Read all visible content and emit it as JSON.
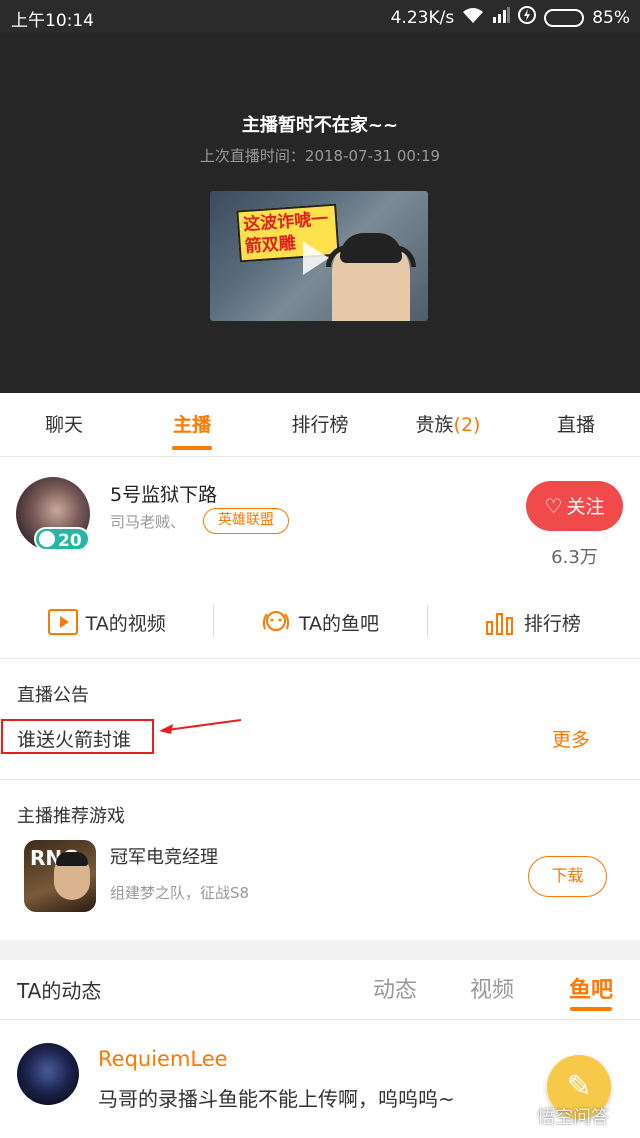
{
  "status_bar": {
    "time": "上午10:14",
    "network_speed": "4.23K/s",
    "battery": "85%",
    "battery_level": 0.85
  },
  "player": {
    "offline_title": "主播暂时不在家~~",
    "last_live": "上次直播时间：2018-07-31  00:19",
    "replay_caption": "这波诈唬一箭双雕"
  },
  "tabs": [
    {
      "label": "聊天"
    },
    {
      "label": "主播"
    },
    {
      "label": "排行榜"
    },
    {
      "label": "贵族",
      "count": "(2)"
    },
    {
      "label": "直播"
    }
  ],
  "anchor": {
    "name": "5号监狱下路",
    "nickname": "司马老贼、",
    "category": "英雄联盟",
    "level": "20",
    "follow_label": "关注",
    "followers": "6.3万"
  },
  "shortcuts": [
    {
      "label": "TA的视频",
      "icon": "video-icon"
    },
    {
      "label": "TA的鱼吧",
      "icon": "fish-bar-icon"
    },
    {
      "label": "排行榜",
      "icon": "rank-bars-icon"
    }
  ],
  "announcement": {
    "title": "直播公告",
    "text": "谁送火箭封谁",
    "more": "更多"
  },
  "recommended_game": {
    "section_title": "主播推荐游戏",
    "icon_text": "RNG",
    "name": "冠军电竞经理",
    "description": "组建梦之队，征战S8",
    "download": "下载"
  },
  "dynamics": {
    "title": "TA的动态",
    "tabs": [
      "动态",
      "视频",
      "鱼吧"
    ],
    "active_tab": "鱼吧",
    "post": {
      "user": "RequiemLee",
      "text": "马哥的录播斗鱼能不能上传啊，呜呜呜~"
    }
  },
  "watermark": "悟空问答",
  "colors": {
    "accent": "#ff7800",
    "follow": "#f04a4a",
    "annotation": "#e62020"
  }
}
